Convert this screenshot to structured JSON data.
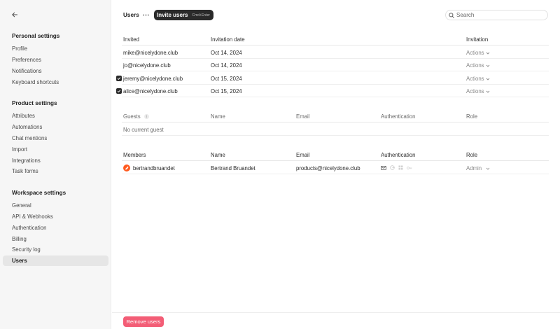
{
  "sidebar": {
    "back_icon": "arrow-left-icon",
    "groups": [
      {
        "title": "Personal settings",
        "items": [
          "Profile",
          "Preferences",
          "Notifications",
          "Keyboard shortcuts"
        ]
      },
      {
        "title": "Product settings",
        "items": [
          "Attributes",
          "Automations",
          "Chat mentions",
          "Import",
          "Integrations",
          "Task forms"
        ]
      },
      {
        "title": "Workspace settings",
        "items": [
          "General",
          "API & Webhooks",
          "Authentication",
          "Billing",
          "Security log",
          "Users"
        ]
      }
    ],
    "active_item": "Users"
  },
  "header": {
    "title": "Users",
    "invite_label": "Invite users",
    "invite_shortcut": "Cmd+Enter",
    "search_placeholder": "Search"
  },
  "invited": {
    "columns": [
      "Invited",
      "Invitation date",
      "Invitation"
    ],
    "rows": [
      {
        "email": "mike@nicelydone.club",
        "date": "Oct 14, 2024",
        "action": "Actions",
        "checked": false
      },
      {
        "email": "jo@nicelydone.club",
        "date": "Oct 14, 2024",
        "action": "Actions",
        "checked": false
      },
      {
        "email": "jeremy@nicelydone.club",
        "date": "Oct 15, 2024",
        "action": "Actions",
        "checked": true
      },
      {
        "email": "alice@nicelydone.club",
        "date": "Oct 15, 2024",
        "action": "Actions",
        "checked": true
      }
    ]
  },
  "guests": {
    "columns": [
      "Guests",
      "Name",
      "Email",
      "Authentication",
      "Role"
    ],
    "empty_text": "No current guest"
  },
  "members": {
    "columns": [
      "Members",
      "Name",
      "Email",
      "Authentication",
      "Role"
    ],
    "rows": [
      {
        "username": "bertrandbruandet",
        "name": "Bertrand Bruandet",
        "email": "products@nicelydone.club",
        "role": "Admin"
      }
    ]
  },
  "footer": {
    "remove_label": "Remove users"
  },
  "colors": {
    "remove_button": "#f35d76",
    "invite_button": "#2a2a2a",
    "avatar": "#ff5a1f"
  }
}
